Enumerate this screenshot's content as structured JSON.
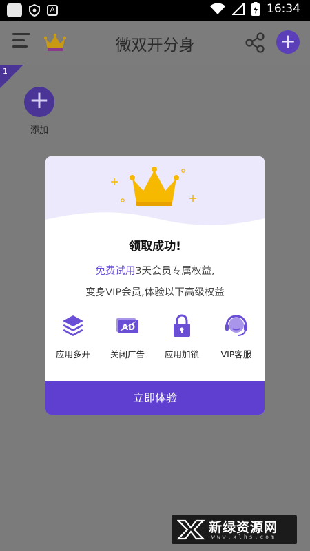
{
  "status_bar": {
    "time": "16:34",
    "icons": [
      "app-square-icon",
      "shield-icon",
      "a-badge-icon",
      "wifi-icon",
      "signal-icon",
      "battery-charging-icon"
    ],
    "a_label": "A"
  },
  "app_bar": {
    "title": "微双开分身",
    "icons": [
      "menu-icon",
      "crown-icon",
      "share-icon",
      "add-icon"
    ],
    "add_symbol": "+"
  },
  "content": {
    "badge_number": "1",
    "add_symbol": "+",
    "add_label": "添加"
  },
  "dialog": {
    "title": "领取成功!",
    "line1_highlight": "免费试用",
    "line1_rest": "3天会员专属权益,",
    "line2": "变身VIP会员,体验以下高级权益",
    "features": [
      {
        "label": "应用多开",
        "icon": "layers-icon"
      },
      {
        "label": "关闭广告",
        "icon": "ad-block-icon"
      },
      {
        "label": "应用加锁",
        "icon": "lock-icon"
      },
      {
        "label": "VIP客服",
        "icon": "headset-icon"
      }
    ],
    "cta_label": "立即体验",
    "accent_color": "#5f3fcf",
    "crown_color": "#f7b800"
  },
  "watermark": {
    "text": "新绿资源网",
    "sub": "www.xlhs.com"
  }
}
